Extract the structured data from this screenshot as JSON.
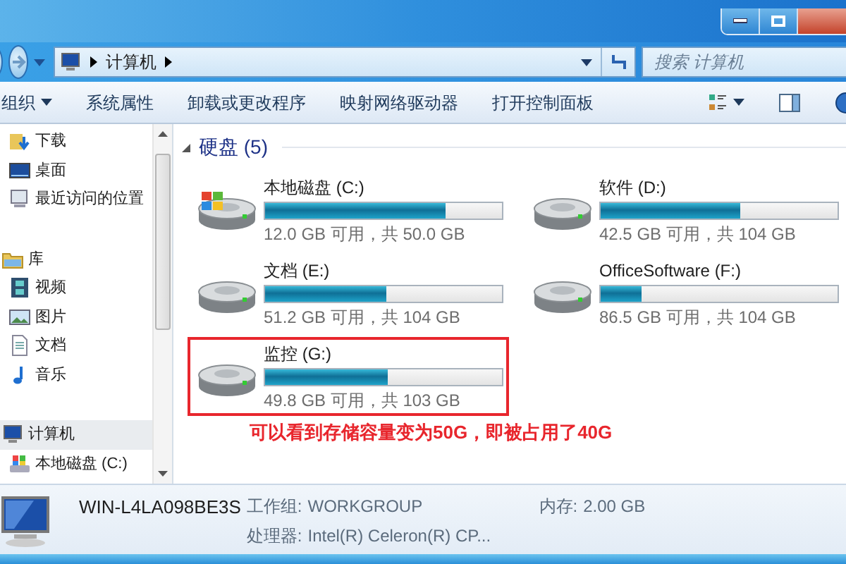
{
  "address_bar": {
    "path": [
      "计算机"
    ],
    "search_placeholder": "搜索 计算机"
  },
  "toolbar": {
    "items": [
      {
        "label": "组织",
        "dropdown": true
      },
      {
        "label": "系统属性",
        "dropdown": false
      },
      {
        "label": "卸载或更改程序",
        "dropdown": false
      },
      {
        "label": "映射网络驱动器",
        "dropdown": false
      },
      {
        "label": "打开控制面板",
        "dropdown": false
      }
    ]
  },
  "sidebar": {
    "sections": [
      {
        "items": [
          {
            "label": "下载",
            "kind": "download",
            "selected": false
          },
          {
            "label": "桌面",
            "kind": "desktop",
            "selected": false
          },
          {
            "label": "最近访问的位置",
            "kind": "recent",
            "selected": false
          }
        ]
      },
      {
        "label": "库",
        "kind": "library",
        "selected": false,
        "items": [
          {
            "label": "视频",
            "kind": "video",
            "selected": false
          },
          {
            "label": "图片",
            "kind": "picture",
            "selected": false
          },
          {
            "label": "文档",
            "kind": "document",
            "selected": false
          },
          {
            "label": "音乐",
            "kind": "music",
            "selected": false
          }
        ]
      },
      {
        "label": "计算机",
        "kind": "computer",
        "selected": true,
        "items": [
          {
            "label": "本地磁盘 (C:)",
            "kind": "system-drive",
            "selected": false
          }
        ]
      }
    ]
  },
  "content": {
    "section_title": "硬盘 (5)",
    "drives": [
      {
        "name": "本地磁盘 (C:)",
        "kind": "system",
        "level": 0.76,
        "space": "12.0 GB 可用，共 50.0 GB",
        "highlighted": false
      },
      {
        "name": "软件 (D:)",
        "kind": "plain",
        "level": 0.59,
        "space": "42.5 GB 可用，共 104 GB",
        "highlighted": false
      },
      {
        "name": "文档 (E:)",
        "kind": "plain",
        "level": 0.51,
        "space": "51.2 GB 可用，共 104 GB",
        "highlighted": false
      },
      {
        "name": "OfficeSoftware (F:)",
        "kind": "plain",
        "level": 0.17,
        "space": "86.5 GB 可用，共 104 GB",
        "highlighted": false
      },
      {
        "name": "监控 (G:)",
        "kind": "plain",
        "level": 0.52,
        "space": "49.8 GB 可用，共 103 GB",
        "highlighted": true
      }
    ],
    "annotation": "可以看到存储容量变为50G，即被占用了40G"
  },
  "details": {
    "computer_name": "WIN-L4LA098BE3S",
    "fields": [
      {
        "label": "工作组:",
        "value": "WORKGROUP"
      },
      {
        "label": "内存:",
        "value": "2.00 GB"
      },
      {
        "label": "处理器:",
        "value": "Intel(R) Celeron(R) CP..."
      }
    ]
  }
}
